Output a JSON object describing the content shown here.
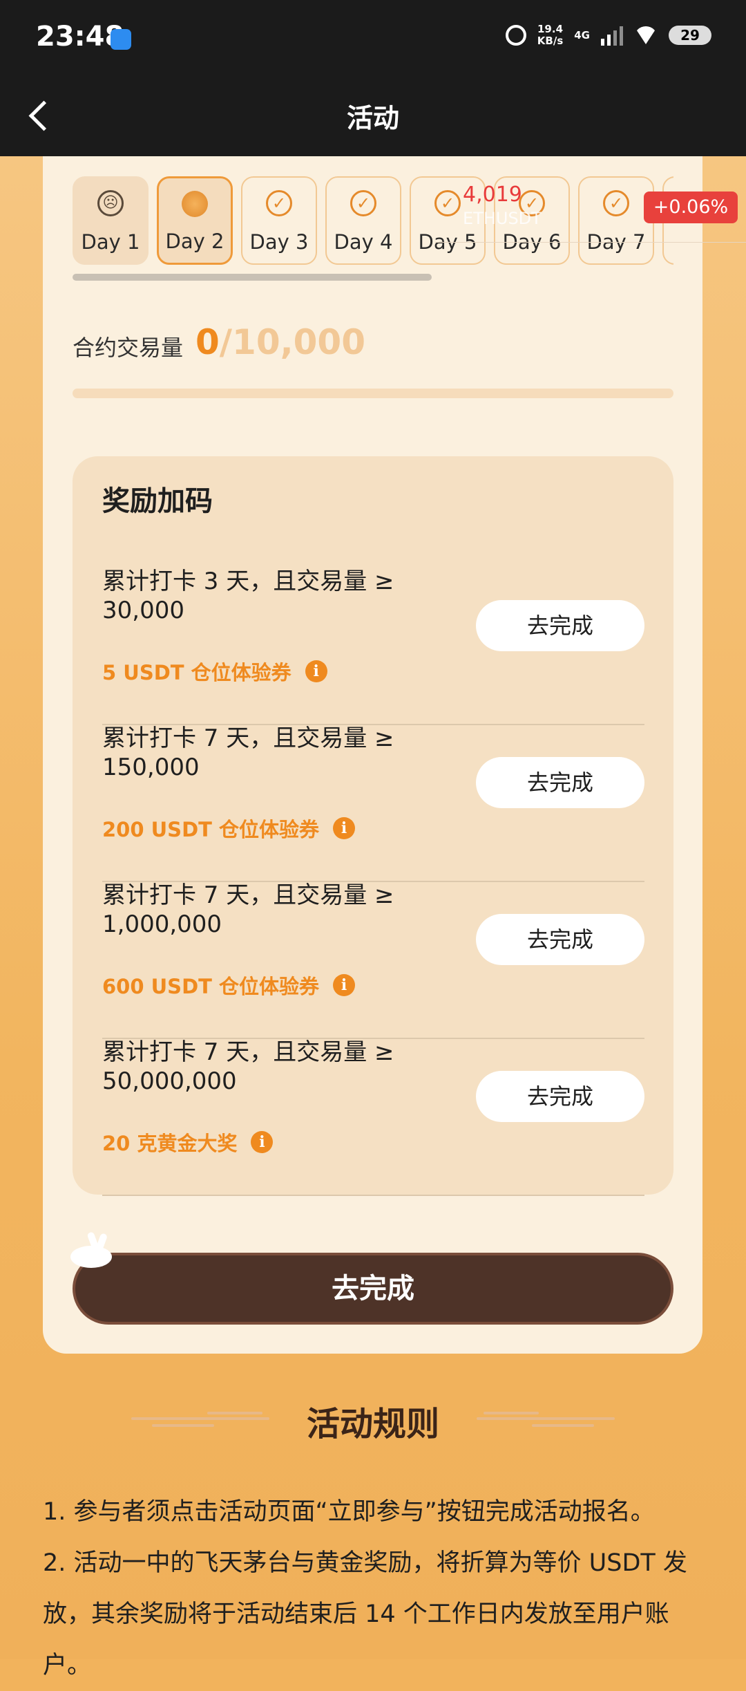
{
  "status_bar": {
    "time": "23:48",
    "speed": "19.4",
    "speed_unit": "KB/s",
    "network": "4G",
    "battery": "29"
  },
  "nav": {
    "title": "活动"
  },
  "days": [
    {
      "label": "Day 1",
      "state": "missed",
      "icon": "sad-face-icon"
    },
    {
      "label": "Day 2",
      "state": "current",
      "icon": "coin-icon"
    },
    {
      "label": "Day 3",
      "state": "future",
      "icon": "check-circle-icon"
    },
    {
      "label": "Day 4",
      "state": "future",
      "icon": "check-circle-icon"
    },
    {
      "label": "Day 5",
      "state": "future",
      "icon": "check-circle-icon"
    },
    {
      "label": "Day 6",
      "state": "future",
      "icon": "check-circle-icon"
    },
    {
      "label": "Day 7",
      "state": "future",
      "icon": "check-circle-icon"
    }
  ],
  "ticker": {
    "price": "4,019",
    "symbol": "ETHUSDT",
    "change": "+0.06%"
  },
  "volume": {
    "label": "合约交易量",
    "current": "0",
    "total": "/10,000"
  },
  "bonus": {
    "title": "奖励加码",
    "tasks": [
      {
        "desc": "累计打卡 3 天，且交易量 ≥ 30,000",
        "reward": "5 USDT 仓位体验券",
        "button": "去完成"
      },
      {
        "desc": "累计打卡 7 天，且交易量 ≥ 150,000",
        "reward": "200 USDT 仓位体验券",
        "button": "去完成"
      },
      {
        "desc": "累计打卡 7 天，且交易量 ≥ 1,000,000",
        "reward": "600 USDT 仓位体验券",
        "button": "去完成"
      },
      {
        "desc": "累计打卡 7 天，且交易量 ≥ 50,000,000",
        "reward": "20 克黄金大奖",
        "button": "去完成"
      }
    ]
  },
  "main_button": "去完成",
  "rules": {
    "title": "活动规则",
    "items": [
      "1. 参与者须点击活动页面“立即参与”按钮完成活动报名。",
      "2. 活动一中的飞天茅台与黄金奖励，将折算为等价 USDT 发放，其余奖励将于活动结束后 14 个工作日内发放至用户账户。"
    ]
  },
  "colors": {
    "accent": "#ef8a1f",
    "card": "#fbf0de",
    "button_dark": "#4e3328",
    "ticker_red": "#e8413c"
  }
}
